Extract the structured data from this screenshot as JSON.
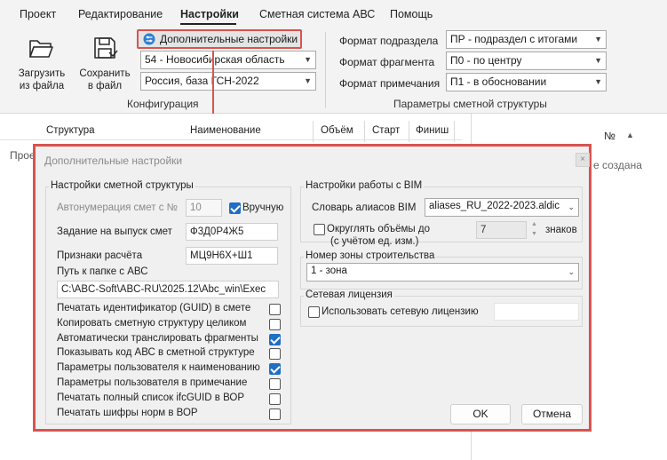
{
  "menu": {
    "items": [
      "Проект",
      "Редактирование",
      "Настройки",
      "Сметная система АВС",
      "Помощь"
    ],
    "active": "Настройки"
  },
  "ribbon": {
    "load_label_1": "Загрузить",
    "load_label_2": "из файла",
    "save_label_1": "Сохранить",
    "save_label_2": "в файл",
    "additional_settings_label": "Дополнительные настройки",
    "region_value": "54 - Новосибирская область",
    "base_value": "Россия, база ГСН-2022",
    "config_group_label": "Конфигурация",
    "subsection_format_label": "Формат подраздела",
    "subsection_format_value": "ПР - подраздел с итогами",
    "fragment_format_label": "Формат фрагмента",
    "fragment_format_value": "П0 - по центру",
    "note_format_label": "Формат примечания",
    "note_format_value": "П1 - в обосновании",
    "structure_params_group_label": "Параметры сметной структуры"
  },
  "grid": {
    "col_structure": "Структура",
    "col_name": "Наименование",
    "col_volume": "Объём",
    "col_start": "Старт",
    "col_finish": "Финиш",
    "left_cell_partial": "Прое",
    "right_col_number": "№",
    "right_cell_partial": "е создана"
  },
  "dialog": {
    "title": "Дополнительные настройки",
    "close_glyph": "×",
    "structure_group": {
      "legend": "Настройки сметной структуры",
      "autonumber_label": "Автонумерация смет с №",
      "autonumber_value": "10",
      "manual_label": "Вручную",
      "manual_checked": true,
      "task_label": "Задание на выпуск смет",
      "task_value": "Ф3Д0Р4Ж5",
      "calc_label": "Признаки расчёта",
      "calc_value": "МЦ9Н6Х+Ш1",
      "path_label": "Путь к папке с АВС",
      "path_value": "C:\\ABC-Soft\\ABC-RU\\2025.12\\Abc_win\\Exec",
      "options": [
        {
          "label": "Печатать идентификатор (GUID) в смете",
          "checked": false
        },
        {
          "label": "Копировать сметную структуру целиком",
          "checked": false
        },
        {
          "label": "Автоматически транслировать фрагменты",
          "checked": true
        },
        {
          "label": "Показывать код АВС в сметной структуре",
          "checked": false
        },
        {
          "label": "Параметры пользователя к наименованию",
          "checked": true
        },
        {
          "label": "Параметры пользователя в примечание",
          "checked": false
        },
        {
          "label": "Печатать полный список ifcGUID в ВОР",
          "checked": false
        },
        {
          "label": "Печатать шифры норм в ВОР",
          "checked": false
        }
      ]
    },
    "bim_group": {
      "legend": "Настройки работы с BIM",
      "dict_label": "Словарь алиасов BIM",
      "dict_value": "aliases_RU_2022-2023.aldic",
      "round_label_1": "Округлять объёмы до",
      "round_label_2": "(с учётом ед. изм.)",
      "round_checked": false,
      "round_value": "7",
      "round_unit": "знаков"
    },
    "zone_group": {
      "legend": "Номер зоны строительства",
      "value": "1 - зона"
    },
    "license_group": {
      "legend": "Сетевая лицензия",
      "use_label": "Использовать сетевую лицензию",
      "use_checked": false,
      "value": ""
    },
    "ok_label": "OK",
    "cancel_label": "Отмена"
  },
  "colors": {
    "highlight": "#d9534f",
    "check_accent": "#1f6fc5",
    "ribbon_bg": "#f3f3f3",
    "dialog_bg": "#f0f0f0"
  }
}
